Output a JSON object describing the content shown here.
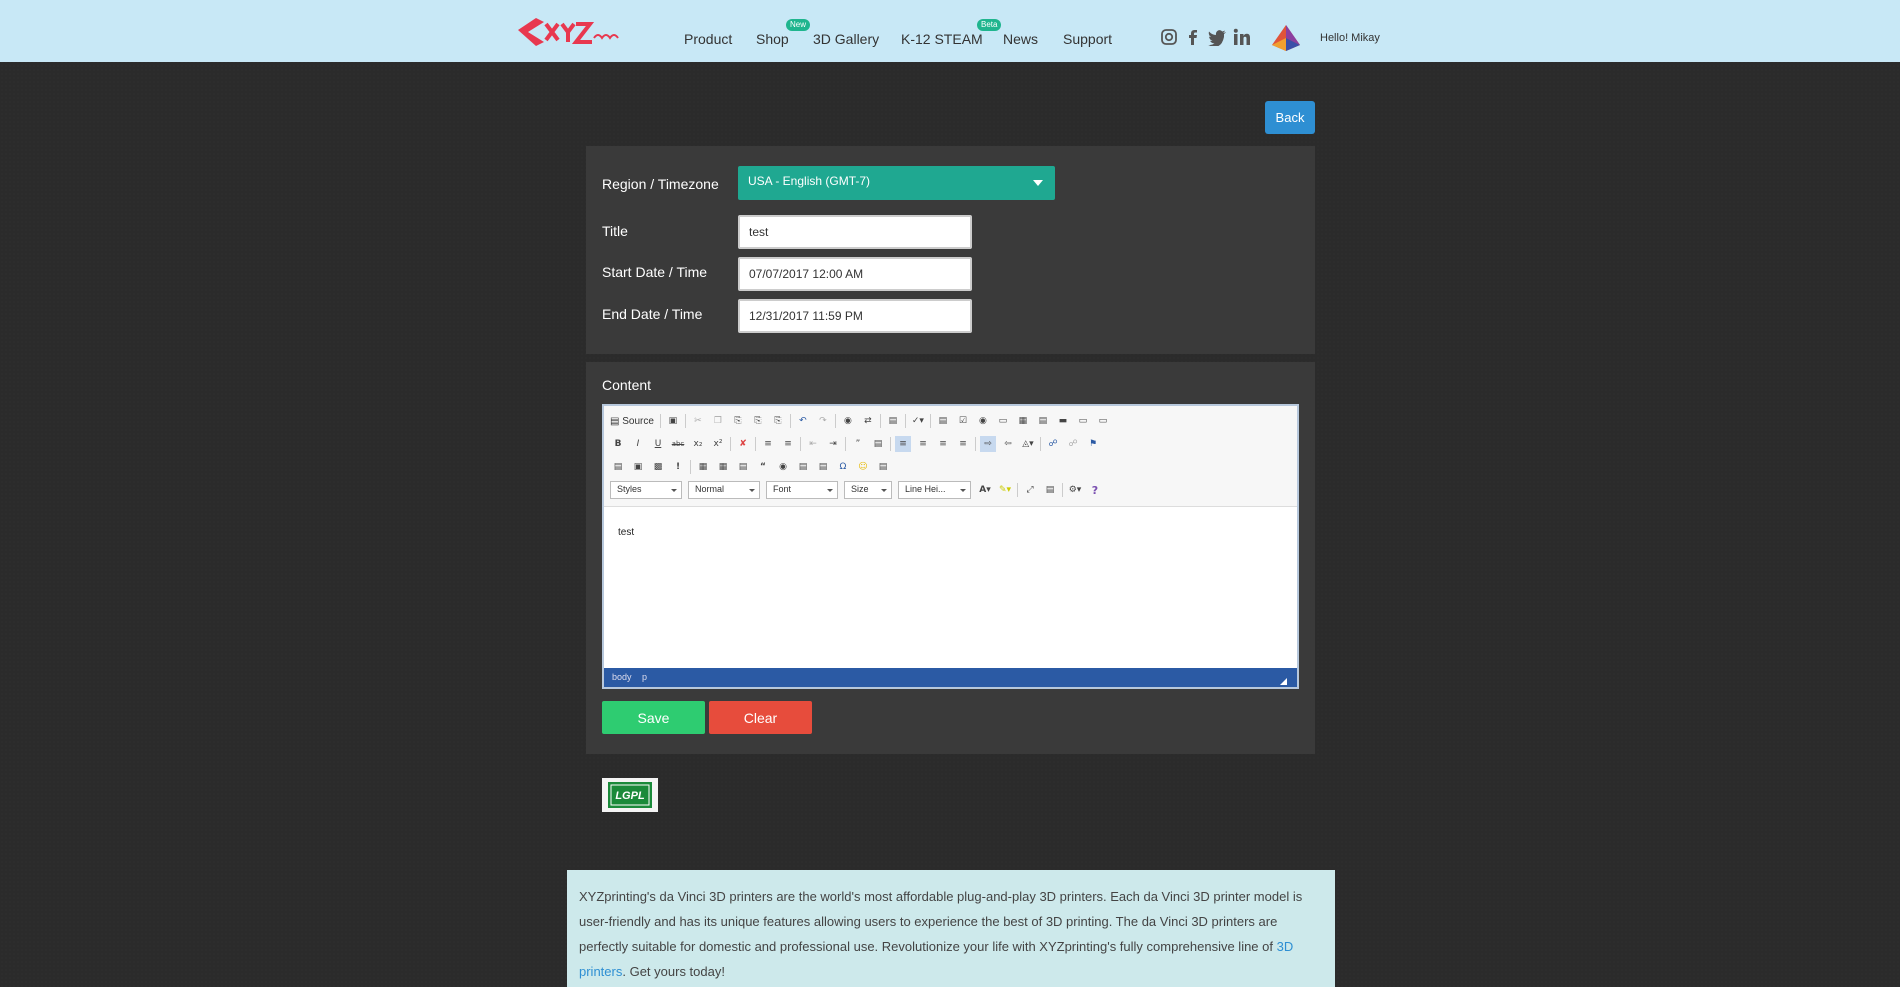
{
  "header": {
    "nav": [
      {
        "label": "Product"
      },
      {
        "label": "Shop",
        "badge": "New"
      },
      {
        "label": "3D Gallery"
      },
      {
        "label": "K-12 STEAM",
        "badge": "Beta"
      },
      {
        "label": "News"
      },
      {
        "label": "Support"
      }
    ],
    "social_icons": [
      "instagram-icon",
      "facebook-icon",
      "twitter-icon",
      "linkedin-icon"
    ],
    "greeting": "Hello! Mikay"
  },
  "back_label": "Back",
  "form": {
    "region_label": "Region / Timezone",
    "region_value": "USA - English (GMT-7)",
    "title_label": "Title",
    "title_value": "test",
    "start_label": "Start Date / Time",
    "start_value": "07/07/2017 12:00 AM",
    "end_label": "End Date / Time",
    "end_value": "12/31/2017 11:59 PM"
  },
  "content": {
    "label": "Content",
    "toolbar": {
      "source_label": "Source",
      "combos": [
        "Styles",
        "Normal",
        "Font",
        "Size",
        "Line Hei..."
      ]
    },
    "body_text": "test",
    "status_path": [
      "body",
      "p"
    ]
  },
  "actions": {
    "save_label": "Save",
    "clear_label": "Clear"
  },
  "badge_logo": "LGPL",
  "promo": {
    "text_before": "XYZprinting's da Vinci 3D printers are the world's most affordable plug-and-play 3D printers. Each da Vinci 3D printer model is user-friendly and has its unique features allowing users to experience the best of 3D printing. The da Vinci 3D printers are perfectly suitable for domestic and professional use. Revolutionize your life with XYZprinting's fully comprehensive line of ",
    "link_text": "3D printers",
    "text_after": ". Get yours today!"
  },
  "colors": {
    "header_bg": "#c8e8f6",
    "page_bg": "#2b2b2b",
    "panel_bg": "#3a3a3a",
    "select_bg": "#1fa891",
    "save": "#2ecc71",
    "clear": "#e74c3c",
    "back": "#2e8fd3"
  }
}
